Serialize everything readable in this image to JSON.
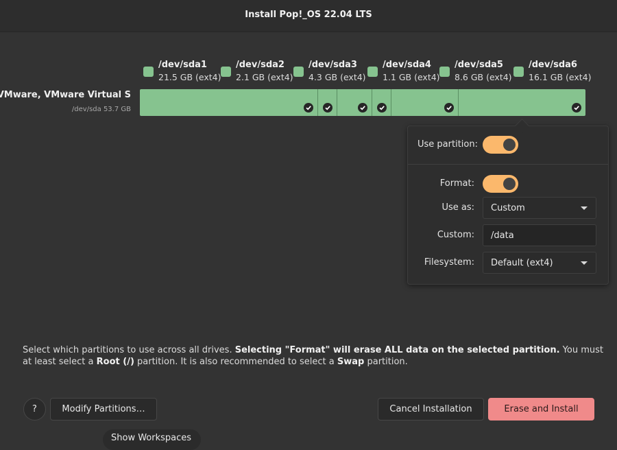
{
  "window": {
    "title": "Install Pop!_OS 22.04 LTS"
  },
  "legend": [
    {
      "name": "/dev/sda1",
      "size": "21.5 GB (ext4)"
    },
    {
      "name": "/dev/sda2",
      "size": "2.1 GB (ext4)"
    },
    {
      "name": "/dev/sda3",
      "size": "4.3 GB (ext4)"
    },
    {
      "name": "/dev/sda4",
      "size": "1.1 GB (ext4)"
    },
    {
      "name": "/dev/sda5",
      "size": "8.6 GB (ext4)"
    },
    {
      "name": "/dev/sda6",
      "size": "16.1 GB (ext4)"
    }
  ],
  "partition_color": "#86c38f",
  "drive": {
    "name": "VMware, VMware Virtual S",
    "subtitle": "/dev/sda 53.7 GB",
    "partitions_selected": [
      true,
      true,
      true,
      true,
      true,
      true
    ]
  },
  "popover": {
    "use_partition_label": "Use partition:",
    "use_partition_on": true,
    "format_label": "Format:",
    "format_on": true,
    "use_as_label": "Use as:",
    "use_as_value": "Custom",
    "custom_label": "Custom:",
    "custom_value": "/data",
    "filesystem_label": "Filesystem:",
    "filesystem_value": "Default (ext4)",
    "toggle_color": "#fbb86c"
  },
  "help": {
    "t1": "Select which partitions to use across all drives. ",
    "b1": "Selecting \"Format\" will erase ALL data on the selected partition.",
    "t2": " You must at least select a ",
    "b2": "Root (/)",
    "t3": " partition. It is also recommended to select a ",
    "b3": "Swap",
    "t4": " partition."
  },
  "buttons": {
    "help": "?",
    "modify": "Modify Partitions…",
    "cancel": "Cancel Installation",
    "erase": "Erase and Install",
    "erase_color": "#f08a8a"
  },
  "workspaces": {
    "label": "Show Workspaces"
  }
}
